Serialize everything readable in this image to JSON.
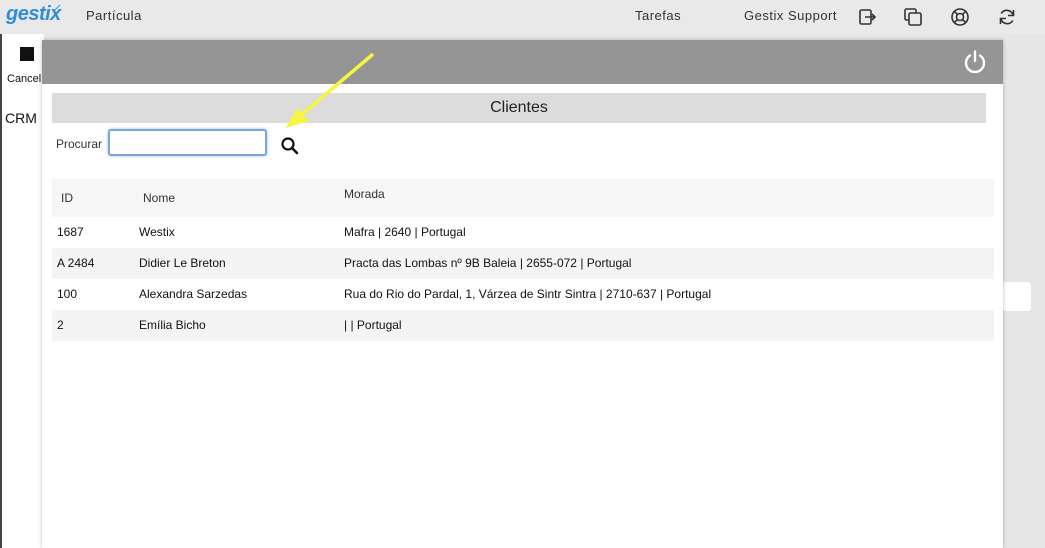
{
  "topbar": {
    "logo": "gestix",
    "app_name": "Partícula",
    "tasks": "Tarefas",
    "user": "Gestix Support"
  },
  "background": {
    "cancel_text": "Cancel",
    "crm_text": "CRM"
  },
  "modal": {
    "title": "Clientes",
    "search_label": "Procurar",
    "search_value": "",
    "columns": [
      "ID",
      "Nome",
      "Morada"
    ],
    "rows": [
      {
        "id": "1687",
        "name": "Westix",
        "address": "Mafra | 2640 | Portugal"
      },
      {
        "id": "A 2484",
        "name": "Didier Le Breton",
        "address": "Practa das Lombas nº 9B Baleia | 2655-072 | Portugal"
      },
      {
        "id": "100",
        "name": "Alexandra Sarzedas",
        "address": "Rua do Rio do Pardal, 1, Várzea de Sintr Sintra | 2710-637 | Portugal"
      },
      {
        "id": "2",
        "name": "Emília Bicho",
        "address": "| | Portugal"
      }
    ]
  },
  "icons": {
    "exit": "exit-icon",
    "windows": "windows-icon",
    "help": "lifebuoy-icon",
    "refresh": "refresh-icon",
    "power": "power-icon",
    "search": "search-icon"
  },
  "colors": {
    "brand": "#2f8fd6",
    "modal_header": "#959595",
    "arrow": "#f5f542"
  }
}
